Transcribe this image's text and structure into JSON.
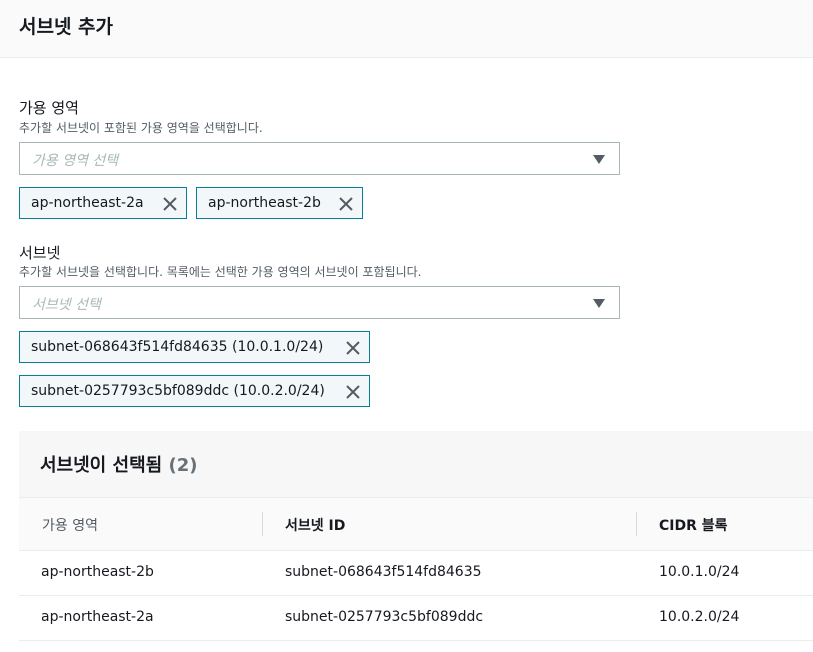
{
  "page": {
    "title": "서브넷 추가"
  },
  "az_field": {
    "label": "가용 영역",
    "description": "추가할 서브넷이 포함된 가용 영역을 선택합니다.",
    "placeholder": "가용 영역 선택",
    "tokens": [
      "ap-northeast-2a",
      "ap-northeast-2b"
    ]
  },
  "subnet_field": {
    "label": "서브넷",
    "description": "추가할 서브넷을 선택합니다. 목록에는 선택한 가용 영역의 서브넷이 포함됩니다.",
    "placeholder": "서브넷 선택",
    "tokens": [
      "subnet-068643f514fd84635 (10.0.1.0/24)",
      "subnet-0257793c5bf089ddc (10.0.2.0/24)"
    ]
  },
  "selected_panel": {
    "title": "서브넷이 선택됨",
    "count": "(2)",
    "columns": [
      "가용 영역",
      "서브넷 ID",
      "CIDR 블록"
    ],
    "rows": [
      [
        "ap-northeast-2b",
        "subnet-068643f514fd84635",
        "10.0.1.0/24"
      ],
      [
        "ap-northeast-2a",
        "subnet-0257793c5bf089ddc",
        "10.0.2.0/24"
      ]
    ]
  },
  "icons": {
    "token_remove": "close-icon",
    "dropdown": "caret-down-icon"
  },
  "colors": {
    "token_border": "#0a7f91",
    "token_bg": "#f2f8f9",
    "input_border": "#aab7b8"
  }
}
